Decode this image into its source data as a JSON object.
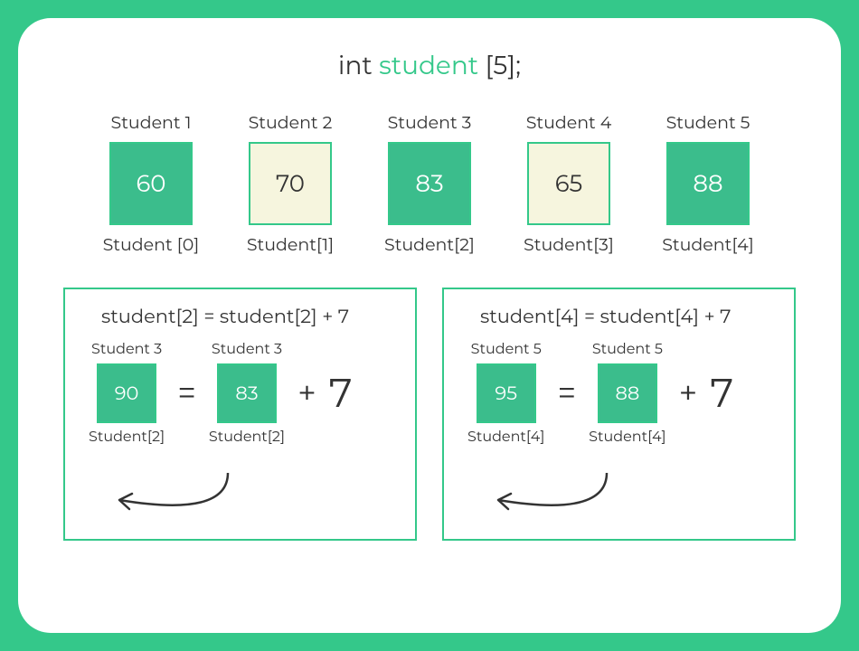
{
  "declaration": {
    "type": "int",
    "name": "student",
    "size": "[5];"
  },
  "array": [
    {
      "top": "Student 1",
      "value": "60",
      "bottom": "Student [0]",
      "variant": "green"
    },
    {
      "top": "Student 2",
      "value": "70",
      "bottom": "Student[1]",
      "variant": "cream"
    },
    {
      "top": "Student 3",
      "value": "83",
      "bottom": "Student[2]",
      "variant": "green"
    },
    {
      "top": "Student 4",
      "value": "65",
      "bottom": "Student[3]",
      "variant": "cream"
    },
    {
      "top": "Student 5",
      "value": "88",
      "bottom": "Student[4]",
      "variant": "green"
    }
  ],
  "panels": [
    {
      "expression": "student[2] = student[2] + 7",
      "left": {
        "top": "Student 3",
        "value": "90",
        "bottom": "Student[2]"
      },
      "eq": "=",
      "right": {
        "top": "Student 3",
        "value": "83",
        "bottom": "Student[2]"
      },
      "plus": "+",
      "addend": "7"
    },
    {
      "expression": "student[4] = student[4] + 7",
      "left": {
        "top": "Student 5",
        "value": "95",
        "bottom": "Student[4]"
      },
      "eq": "=",
      "right": {
        "top": "Student 5",
        "value": "88",
        "bottom": "Student[4]"
      },
      "plus": "+",
      "addend": "7"
    }
  ]
}
